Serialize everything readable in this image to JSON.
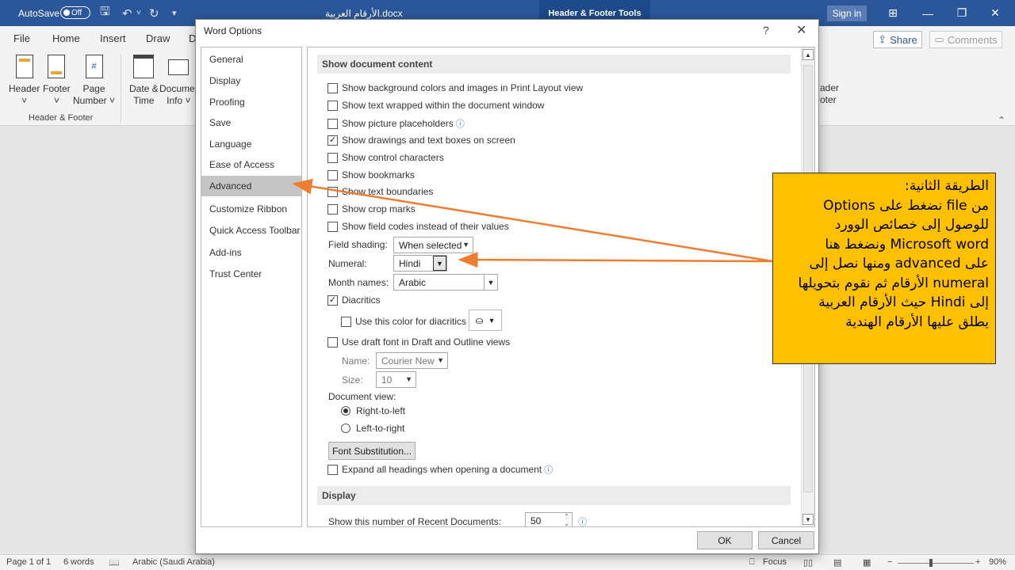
{
  "titlebar": {
    "autosave_label": "AutoSave",
    "autosave_state": "Off",
    "document_title": "الأرقام العربية.docx",
    "context_tab": "Header & Footer Tools",
    "sign_in": "Sign in",
    "icons": [
      "save-icon",
      "undo-icon",
      "redo-icon",
      "customize-icon",
      "ribbon-display-icon",
      "minimize-icon",
      "restore-icon",
      "close-icon"
    ],
    "accent_color": "#2b579a"
  },
  "ribbon": {
    "tabs": [
      "File",
      "Home",
      "Insert",
      "Draw",
      "D"
    ],
    "share": "Share",
    "comments": "Comments",
    "buttons": [
      {
        "label": "Header",
        "sub": "˅"
      },
      {
        "label": "Footer",
        "sub": "˅"
      },
      {
        "label": "Page",
        "sub": "Number ˅"
      },
      {
        "label": "Date &",
        "sub": "Time"
      },
      {
        "label": "Documer",
        "sub": "Info ˅"
      }
    ],
    "partial_right": {
      "line1": "ader",
      "line2": "oter"
    },
    "group_label": "Header & Footer"
  },
  "statusbar": {
    "page": "Page 1 of 1",
    "words": "6 words",
    "language": "Arabic (Saudi Arabia)",
    "focus": "Focus",
    "zoom_minus": "−",
    "zoom_plus": "+",
    "zoom": "90%"
  },
  "dialog": {
    "title": "Word Options",
    "help": "?",
    "close": "✕",
    "nav": [
      {
        "label": "General",
        "selected": false
      },
      {
        "label": "Display",
        "selected": false
      },
      {
        "label": "Proofing",
        "selected": false
      },
      {
        "label": "Save",
        "selected": false
      },
      {
        "label": "Language",
        "selected": false
      },
      {
        "label": "Ease of Access",
        "selected": false
      },
      {
        "label": "Advanced",
        "selected": true
      },
      {
        "label": "Customize Ribbon",
        "selected": false
      },
      {
        "label": "Quick Access Toolbar",
        "selected": false
      },
      {
        "label": "Add-ins",
        "selected": false
      },
      {
        "label": "Trust Center",
        "selected": false
      }
    ],
    "section_show_content": "Show document content",
    "options": [
      {
        "label": "Show background colors and images in Print Layout view",
        "checked": false,
        "info": false
      },
      {
        "label": "Show text wrapped within the document window",
        "checked": false,
        "info": false
      },
      {
        "label": "Show picture placeholders",
        "checked": false,
        "info": true
      },
      {
        "label": "Show drawings and text boxes on screen",
        "checked": true,
        "info": false
      },
      {
        "label": "Show control characters",
        "checked": false,
        "info": false
      },
      {
        "label": "Show bookmarks",
        "checked": false,
        "info": false
      },
      {
        "label": "Show text boundaries",
        "checked": false,
        "info": false
      },
      {
        "label": "Show crop marks",
        "checked": false,
        "info": false
      },
      {
        "label": "Show field codes instead of their values",
        "checked": false,
        "info": false
      }
    ],
    "field_shading": {
      "label": "Field shading:",
      "value": "When selected"
    },
    "numeral": {
      "label": "Numeral:",
      "value": "Hindi"
    },
    "month_names": {
      "label": "Month names:",
      "value": "Arabic"
    },
    "diacritics": {
      "label": "Diacritics",
      "checked": true
    },
    "diacritics_color": {
      "label": "Use this color for diacritics",
      "checked": false
    },
    "draft_font": {
      "label": "Use draft font in Draft and Outline views",
      "checked": false
    },
    "font_name": {
      "label": "Name:",
      "value": "Courier New"
    },
    "font_size": {
      "label": "Size:",
      "value": "10"
    },
    "document_view": {
      "label": "Document view:",
      "rtl": "Right-to-left",
      "ltr": "Left-to-right",
      "selected": "rtl"
    },
    "font_substitution": "Font Substitution...",
    "expand_headings": {
      "label": "Expand all headings when opening a document",
      "checked": false
    },
    "section_display": "Display",
    "recent_docs": {
      "label": "Show this number of Recent Documents:",
      "value": "50"
    },
    "ok": "OK",
    "cancel": "Cancel"
  },
  "annotation": {
    "lines": [
      "الطريقة الثانية:",
      "من file نضغط على Options",
      "للوصول إلى خصائص الوورد",
      "Microsoft word ونضغط هنا",
      "على advanced ومنها نصل إلى",
      "numeral الأرقام ثم نقوم بتحويلها",
      "إلى Hindi حيث الأرقام العربية",
      "يطلق عليها الأرقام الهندية"
    ],
    "box_color": "#ffc000",
    "arrow_color": "#ed7d31"
  }
}
